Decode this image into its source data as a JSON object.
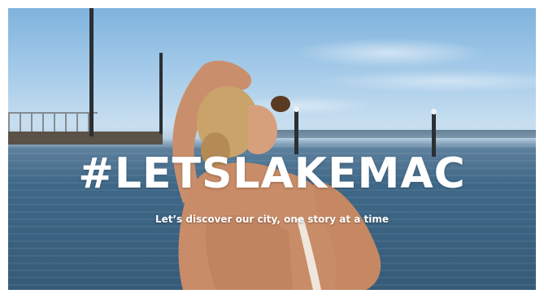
{
  "hero": {
    "hashtag": "#LETSLAKEMAC",
    "tagline": "Let’s discover our city, one story at a time"
  },
  "colors": {
    "sky_top": "#7fb3dd",
    "water": "#355b78",
    "text": "#ffffff"
  }
}
